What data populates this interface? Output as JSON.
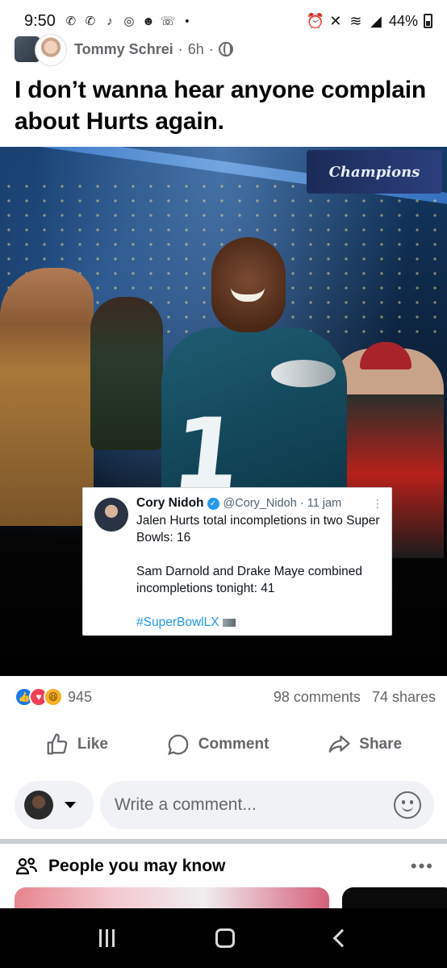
{
  "status_bar": {
    "time": "9:50",
    "battery": "44%",
    "icons_left": [
      "messenger-icon",
      "messenger-icon",
      "tiktok-icon",
      "instagram-icon",
      "reddit-icon",
      "wifi-calling-icon",
      "dot-icon"
    ],
    "icons_right": [
      "alarm-icon",
      "mute-icon",
      "wifi-icon",
      "signal-icon",
      "battery-icon"
    ]
  },
  "post": {
    "author": "Tommy Schrei",
    "time": "6h",
    "separator": "·",
    "privacy_icon": "globe-icon",
    "text": "I don’t wanna hear anyone complain about Hurts again."
  },
  "photo": {
    "sign_text": "Champions",
    "jersey_number": "1",
    "tweet": {
      "name": "Cory Nidoh",
      "handle": "@Cory_Nidoh · 11 jam",
      "line1": "Jalen Hurts total incompletions in two Super Bowls: 16",
      "line2": "Sam Darnold and Drake Maye combined incompletions tonight: 41",
      "hashtag": "#SuperBowlLX"
    }
  },
  "engagement": {
    "reactions": [
      "like",
      "love",
      "haha"
    ],
    "reaction_count": "945",
    "comments": "98 comments",
    "shares": "74 shares"
  },
  "actions": {
    "like": "Like",
    "comment": "Comment",
    "share": "Share"
  },
  "comment_box": {
    "placeholder": "Write a comment..."
  },
  "pymk": {
    "title": "People you may know",
    "more": "•••"
  },
  "colors": {
    "like_blue": "#1877f2",
    "love_red": "#f33e58",
    "haha_yellow": "#f7b125",
    "secondary_text": "#65676b",
    "twitter_blue": "#1d9bf0"
  }
}
